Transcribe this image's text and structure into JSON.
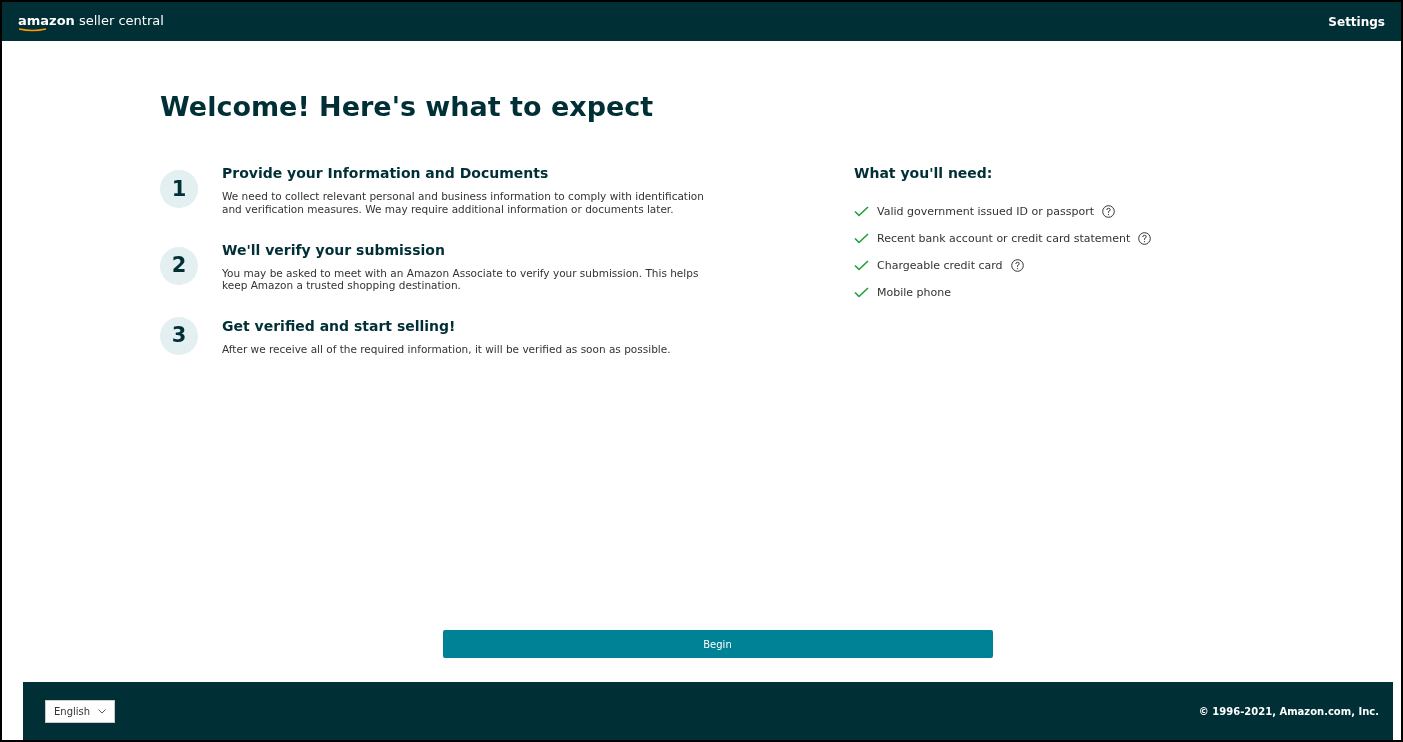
{
  "header": {
    "logo_bold": "amazon",
    "logo_text": "seller central",
    "settings": "Settings"
  },
  "title": "Welcome! Here's what to expect",
  "steps": [
    {
      "number": "1",
      "heading": "Provide your Information and Documents",
      "text": "We need to collect relevant personal and business information to comply with identification and verification measures. We may require additional information or documents later."
    },
    {
      "number": "2",
      "heading": "We'll verify your submission",
      "text": "You may be asked to meet with an Amazon Associate to verify your submission. This helps keep Amazon a trusted shopping destination."
    },
    {
      "number": "3",
      "heading": "Get verified and start selling!",
      "text": "After we receive all of the required information, it will be verified as soon as possible."
    }
  ],
  "needs": {
    "heading": "What you'll need:",
    "items": [
      {
        "label": "Valid government issued ID or passport",
        "help": true
      },
      {
        "label": "Recent bank account or credit card statement",
        "help": true
      },
      {
        "label": "Chargeable credit card",
        "help": true
      },
      {
        "label": "Mobile phone",
        "help": false
      }
    ]
  },
  "begin_button": "Begin",
  "footer": {
    "language": "English",
    "copyright": "© 1996-2021, Amazon.com, Inc."
  }
}
